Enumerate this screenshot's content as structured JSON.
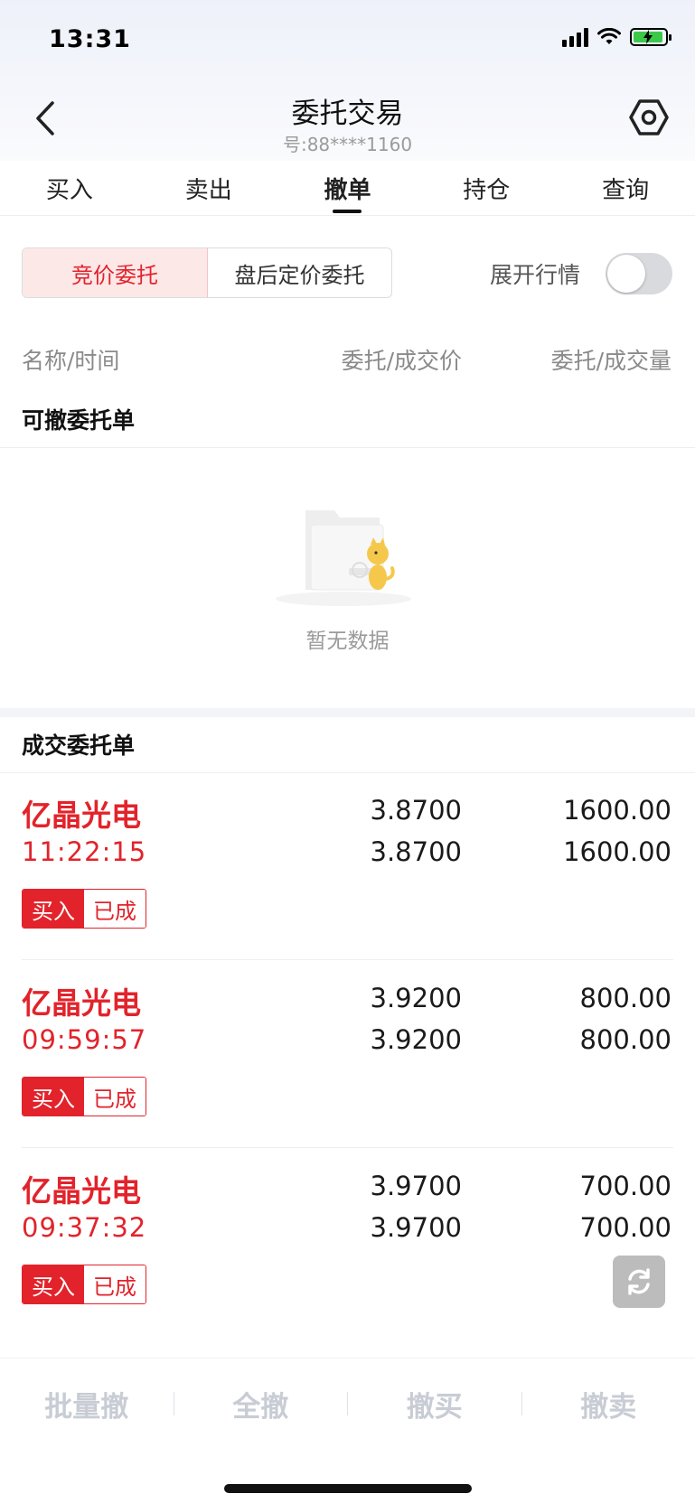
{
  "status_bar": {
    "time": "13:31"
  },
  "header": {
    "title": "委托交易",
    "account": "号:88****1160"
  },
  "tabs": [
    {
      "label": "买入"
    },
    {
      "label": "卖出"
    },
    {
      "label": "撤单",
      "active": true
    },
    {
      "label": "持仓"
    },
    {
      "label": "查询"
    }
  ],
  "segment": {
    "active_label": "竞价委托",
    "other_label": "盘后定价委托"
  },
  "expand_toggle": {
    "label": "展开行情",
    "on": false
  },
  "columns": {
    "name_time": "名称/时间",
    "price": "委托/成交价",
    "quantity": "委托/成交量"
  },
  "cancelable": {
    "title": "可撤委托单",
    "empty_text": "暂无数据"
  },
  "filled": {
    "title": "成交委托单",
    "rows": [
      {
        "name": "亿晶光电",
        "time": "11:22:15",
        "order_price": "3.8700",
        "deal_price": "3.8700",
        "order_qty": "1600.00",
        "deal_qty": "1600.00",
        "side": "买入",
        "status": "已成"
      },
      {
        "name": "亿晶光电",
        "time": "09:59:57",
        "order_price": "3.9200",
        "deal_price": "3.9200",
        "order_qty": "800.00",
        "deal_qty": "800.00",
        "side": "买入",
        "status": "已成"
      },
      {
        "name": "亿晶光电",
        "time": "09:37:32",
        "order_price": "3.9700",
        "deal_price": "3.9700",
        "order_qty": "700.00",
        "deal_qty": "700.00",
        "side": "买入",
        "status": "已成"
      }
    ]
  },
  "bottom_bar": {
    "batch": "批量撤",
    "all": "全撤",
    "cancel_buy": "撤买",
    "cancel_sell": "撤卖"
  },
  "colors": {
    "accent_red": "#e2232b",
    "muted_text": "#8a8a8a",
    "disabled_text": "#c8ccd4"
  }
}
